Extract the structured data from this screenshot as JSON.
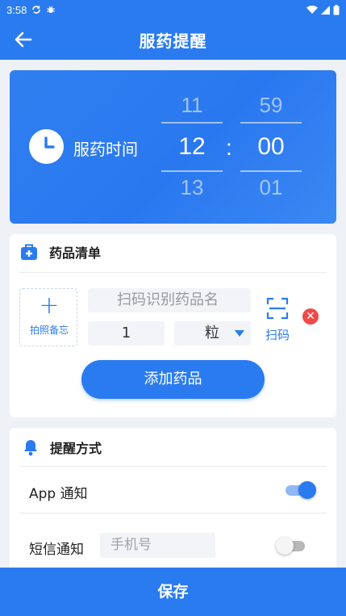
{
  "status_bar": {
    "time": "3:58",
    "battery_icon": "battery-icon",
    "wifi_icon": "wifi-icon",
    "signal_icon": "signal-icon"
  },
  "header": {
    "title": "服药提醒",
    "back_icon": "arrow-left-icon"
  },
  "time_picker": {
    "label": "服药时间",
    "hour": {
      "prev": "11",
      "current": "12",
      "next": "13"
    },
    "separator": ":",
    "minute": {
      "prev": "59",
      "current": "00",
      "next": "01"
    }
  },
  "medicine_list": {
    "title": "药品清单",
    "photo_label": "拍照备忘",
    "scan_placeholder": "扫码识别药品名",
    "quantity": "1",
    "unit": "粒",
    "scan_label": "扫码",
    "add_button": "添加药品"
  },
  "reminder": {
    "title": "提醒方式",
    "app_notice_label": "App 通知",
    "app_notice_enabled": true,
    "sms_label": "短信通知",
    "phone_placeholder": "手机号",
    "sms_enabled": false
  },
  "footer": {
    "save_label": "保存"
  },
  "colors": {
    "primary": "#2a7bf0",
    "danger": "#ef4a4a",
    "background": "#eef1f6"
  }
}
